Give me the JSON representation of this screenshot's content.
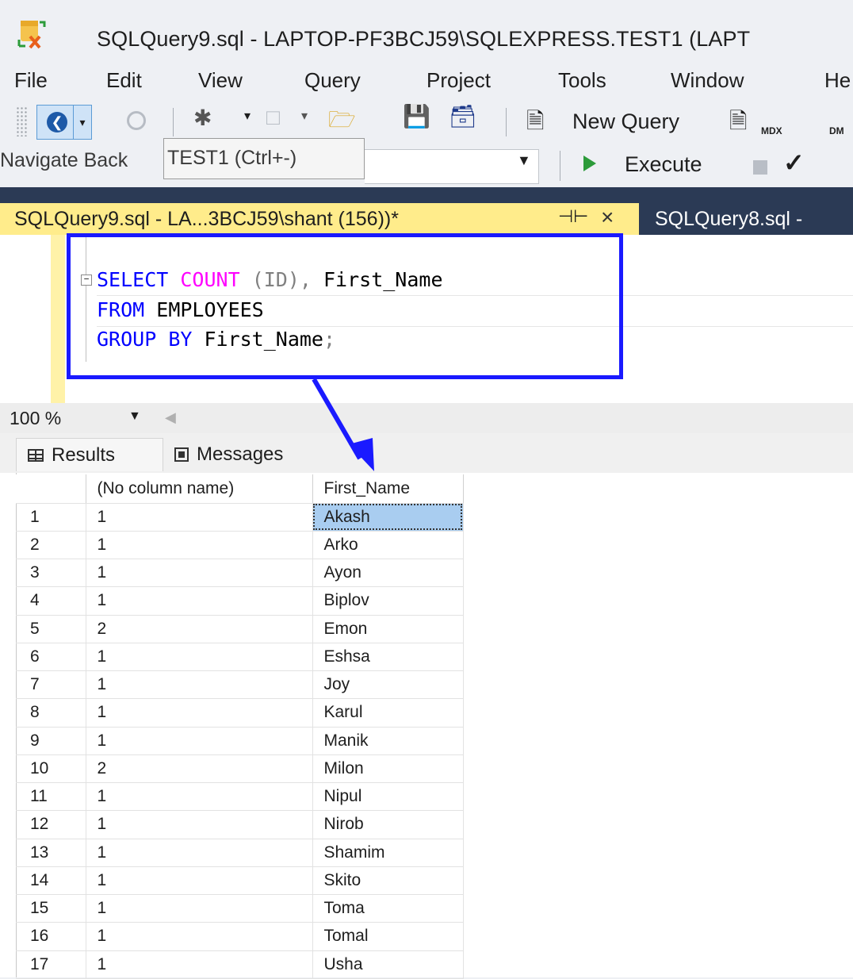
{
  "window": {
    "title": "SQLQuery9.sql - LAPTOP-PF3BCJ59\\SQLEXPRESS.TEST1 (LAPT",
    "app_icon": "ssms-logo-icon"
  },
  "menu": {
    "items": [
      "File",
      "Edit",
      "View",
      "Query",
      "Project",
      "Tools",
      "Window",
      "He"
    ]
  },
  "toolbar": {
    "new_query_label": "New Query",
    "mdx_label": "MDX",
    "dm_label": "DM",
    "navigate_back_tooltip": "Navigate Backward (Ctrl+-)",
    "nav_tip_text": "Navigate Back",
    "database_tooltip": "TEST1 (Ctrl+-)",
    "execute_label": "Execute"
  },
  "tabs": {
    "active_label": "SQLQuery9.sql - LA...3BCJ59\\shant (156))*",
    "pin_glyph": "⊣⊢",
    "close_glyph": "×",
    "inactive_label": "SQLQuery8.sql -"
  },
  "editor": {
    "collapse_glyph": "−",
    "line1": {
      "kw1": "SELECT",
      "fn": "COUNT",
      "rest_gray": " (ID),",
      "rest": " First_Name"
    },
    "line2": {
      "kw": "FROM",
      "rest": " EMPLOYEES"
    },
    "line3": {
      "kw1": "GROUP",
      "kw2": " BY",
      "rest": " First_Name",
      "semi": ";"
    }
  },
  "zoom": {
    "value": "100 %"
  },
  "results_tabs": {
    "results": "Results",
    "messages": "Messages"
  },
  "grid": {
    "headers": [
      "(No column name)",
      "First_Name"
    ],
    "rows": [
      [
        "1",
        "1",
        "Akash"
      ],
      [
        "2",
        "1",
        "Arko"
      ],
      [
        "3",
        "1",
        "Ayon"
      ],
      [
        "4",
        "1",
        "Biplov"
      ],
      [
        "5",
        "2",
        "Emon"
      ],
      [
        "6",
        "1",
        "Eshsa"
      ],
      [
        "7",
        "1",
        "Joy"
      ],
      [
        "8",
        "1",
        "Karul"
      ],
      [
        "9",
        "1",
        "Manik"
      ],
      [
        "10",
        "2",
        "Milon"
      ],
      [
        "11",
        "1",
        "Nipul"
      ],
      [
        "12",
        "1",
        "Nirob"
      ],
      [
        "13",
        "1",
        "Shamim"
      ],
      [
        "14",
        "1",
        "Skito"
      ],
      [
        "15",
        "1",
        "Toma"
      ],
      [
        "16",
        "1",
        "Tomal"
      ],
      [
        "17",
        "1",
        "Usha"
      ]
    ],
    "selected_row": 0
  },
  "colors": {
    "active_tab": "#ffec8b",
    "tab_strip": "#2b3a55",
    "annotation_blue": "#1a1aff",
    "keyword_blue": "#0000ff",
    "function_magenta": "#ff00ff",
    "selection": "#a9cdf0"
  }
}
